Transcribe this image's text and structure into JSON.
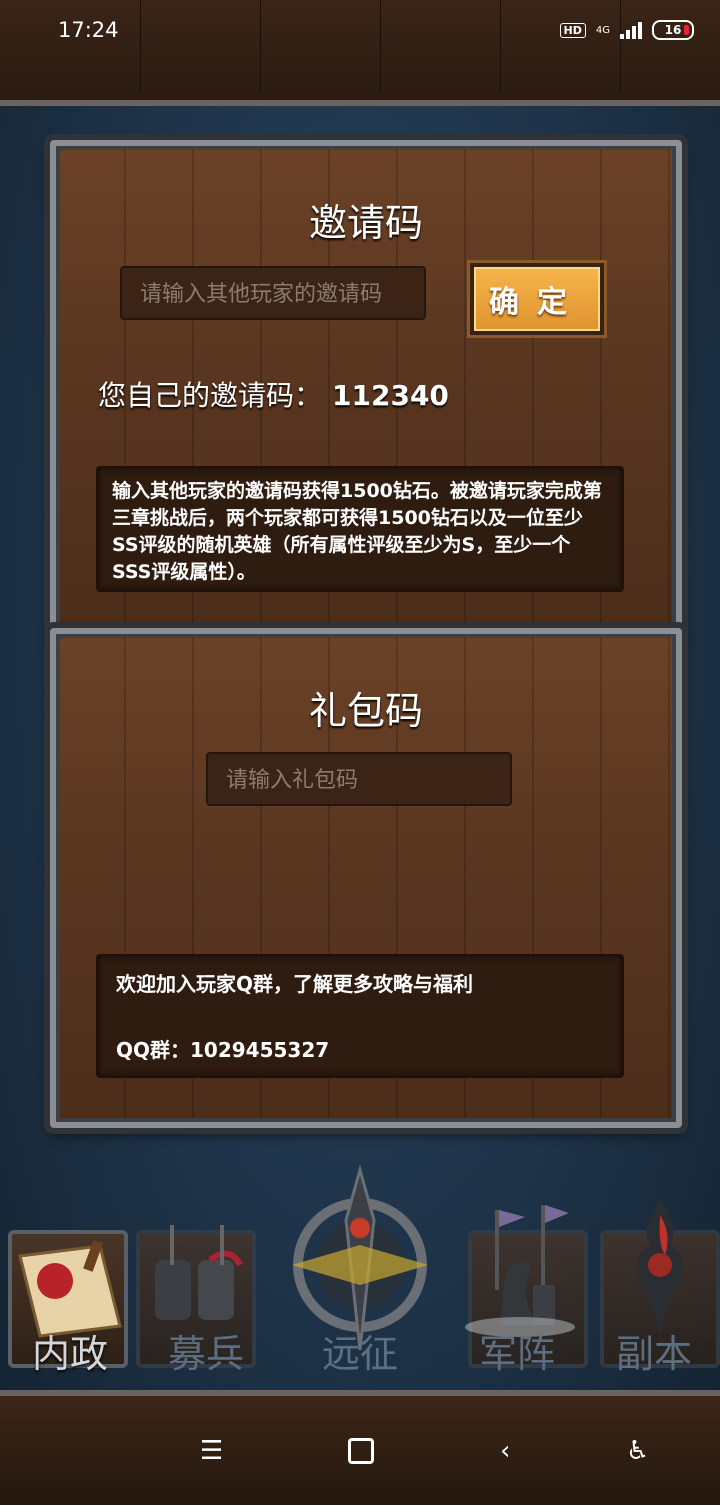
{
  "status": {
    "time": "17:24",
    "hd": "HD",
    "network": "4G",
    "battery": "16"
  },
  "invite": {
    "title": "邀请码",
    "input_placeholder": "请输入其他玩家的邀请码",
    "confirm_label": "确定",
    "my_code_label": "您自己的邀请码：",
    "my_code_value": "112340",
    "description": "输入其他玩家的邀请码获得1500钻石。被邀请玩家完成第三章挑战后，两个玩家都可获得1500钻石以及一位至少SS评级的随机英雄（所有属性评级至少为S，至少一个SSS评级属性）。"
  },
  "gift": {
    "title": "礼包码",
    "input_placeholder": "请输入礼包码",
    "qq_text": "欢迎加入玩家Q群，了解更多攻略与福利",
    "qq_group": "QQ群：1029455327"
  },
  "nav": {
    "tabs": [
      {
        "label": "内政",
        "icon": "scroll-seal-icon",
        "active": true
      },
      {
        "label": "募兵",
        "icon": "knights-icon",
        "active": false
      },
      {
        "label": "远征",
        "icon": "sword-emblem-icon",
        "active": false
      },
      {
        "label": "军阵",
        "icon": "chess-knight-icon",
        "active": false
      },
      {
        "label": "副本",
        "icon": "dark-flame-icon",
        "active": false
      }
    ]
  },
  "colors": {
    "accent": "#f0a43c",
    "panel_wood": "#5a3620",
    "background": "#1f3348"
  }
}
